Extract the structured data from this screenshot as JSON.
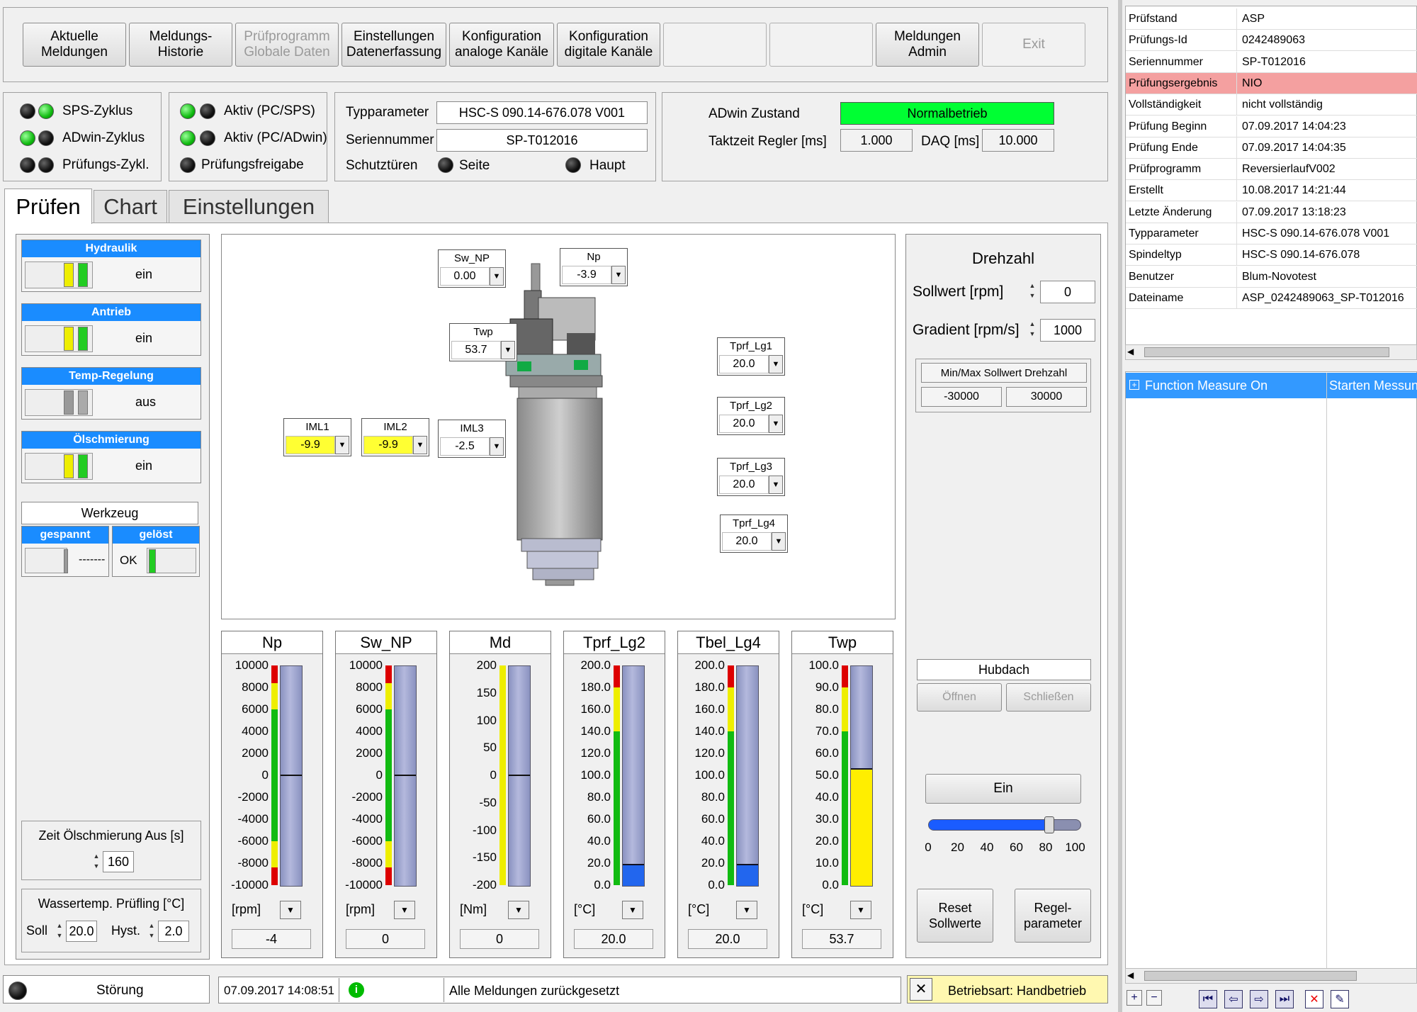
{
  "toolbar": {
    "aktuelle": "Aktuelle\nMeldungen",
    "historie": "Meldungs-\nHistorie",
    "pruefprogramm": "Prüfprogramm\nGlobale Daten",
    "einstellungen": "Einstellungen\nDatenerfassung",
    "analog": "Konfiguration\nanaloge Kanäle",
    "digital": "Konfiguration\ndigitale Kanäle",
    "admin": "Meldungen\nAdmin",
    "exit": "Exit"
  },
  "status": {
    "sps": "SPS-Zyklus",
    "adwin": "ADwin-Zyklus",
    "pruef_zykl": "Prüfungs-Zykl.",
    "aktiv_pc_sps": "Aktiv (PC/SPS)",
    "aktiv_pc_adwin": "Aktiv (PC/ADwin)",
    "freigabe": "Prüfungsfreigabe"
  },
  "info": {
    "typ_label": "Typparameter",
    "typ_value": "HSC-S 090.14-676.078 V001",
    "serien_label": "Seriennummer",
    "serien_value": "SP-T012016",
    "schutz_label": "Schutztüren",
    "seite": "Seite",
    "haupt": "Haupt"
  },
  "adwin": {
    "zustand_label": "ADwin Zustand",
    "zustand_value": "Normalbetrieb",
    "takt_label": "Taktzeit Regler [ms]",
    "takt_value": "1.000",
    "daq_label": "DAQ [ms]",
    "daq_value": "10.000",
    "status_color": "#00ff33"
  },
  "tabs": {
    "pruefen": "Prüfen",
    "chart": "Chart",
    "einstellungen": "Einstellungen"
  },
  "switches": [
    {
      "title": "Hydraulik",
      "value": "ein"
    },
    {
      "title": "Antrieb",
      "value": "ein"
    },
    {
      "title": "Temp-Regelung",
      "value": "aus"
    },
    {
      "title": "Ölschmierung",
      "value": "ein"
    }
  ],
  "werkzeug": {
    "title": "Werkzeug",
    "gespannt": "gespannt",
    "geloest": "gelöst",
    "gespannt_val": "-------",
    "geloest_val": "OK"
  },
  "oel_zeit": {
    "label": "Zeit Ölschmierung Aus [s]",
    "value": "160"
  },
  "wasser": {
    "label": "Wassertemp. Prüfling [°C]",
    "soll_label": "Soll",
    "soll": "20.0",
    "hyst_label": "Hyst.",
    "hyst": "2.0"
  },
  "sensors": {
    "sw_np": {
      "name": "Sw_NP",
      "value": "0.00"
    },
    "np": {
      "name": "Np",
      "value": "-3.9"
    },
    "twp": {
      "name": "Twp",
      "value": "53.7"
    },
    "iml1": {
      "name": "IML1",
      "value": "-9.9"
    },
    "iml2": {
      "name": "IML2",
      "value": "-9.9"
    },
    "iml3": {
      "name": "IML3",
      "value": "-2.5"
    },
    "lg1": {
      "name": "Tprf_Lg1",
      "value": "20.0"
    },
    "lg2": {
      "name": "Tprf_Lg2",
      "value": "20.0"
    },
    "lg3": {
      "name": "Tprf_Lg3",
      "value": "20.0"
    },
    "lg4": {
      "name": "Tprf_Lg4",
      "value": "20.0"
    }
  },
  "gauges": [
    {
      "title": "Np",
      "ticks": [
        "10000",
        "8000",
        "6000",
        "4000",
        "2000",
        "0",
        "-2000",
        "-4000",
        "-6000",
        "-8000",
        "-10000"
      ],
      "unit": "[rpm]",
      "value": "-4",
      "level": 0.5,
      "fill": "line",
      "scale": "symm"
    },
    {
      "title": "Sw_NP",
      "ticks": [
        "10000",
        "8000",
        "6000",
        "4000",
        "2000",
        "0",
        "-2000",
        "-4000",
        "-6000",
        "-8000",
        "-10000"
      ],
      "unit": "[rpm]",
      "value": "0",
      "level": 0.5,
      "fill": "line",
      "scale": "symm"
    },
    {
      "title": "Md",
      "ticks": [
        "200",
        "150",
        "100",
        "50",
        "0",
        "-50",
        "-100",
        "-150",
        "-200"
      ],
      "unit": "[Nm]",
      "value": "0",
      "level": 0.5,
      "fill": "line",
      "scale": "md"
    },
    {
      "title": "Tprf_Lg2",
      "ticks": [
        "200.0",
        "180.0",
        "160.0",
        "140.0",
        "120.0",
        "100.0",
        "80.0",
        "60.0",
        "40.0",
        "20.0",
        "0.0"
      ],
      "unit": "[°C]",
      "value": "20.0",
      "level": 0.1,
      "fill": "blue",
      "scale": "temp"
    },
    {
      "title": "Tbel_Lg4",
      "ticks": [
        "200.0",
        "180.0",
        "160.0",
        "140.0",
        "120.0",
        "100.0",
        "80.0",
        "60.0",
        "40.0",
        "20.0",
        "0.0"
      ],
      "unit": "[°C]",
      "value": "20.0",
      "level": 0.1,
      "fill": "blue",
      "scale": "temp"
    },
    {
      "title": "Twp",
      "ticks": [
        "100.0",
        "90.0",
        "80.0",
        "70.0",
        "60.0",
        "50.0",
        "40.0",
        "30.0",
        "20.0",
        "10.0",
        "0.0"
      ],
      "unit": "[°C]",
      "value": "53.7",
      "level": 0.537,
      "fill": "yellow",
      "scale": "temp"
    }
  ],
  "drehzahl": {
    "title": "Drehzahl",
    "soll_label": "Sollwert [rpm]",
    "soll": "0",
    "grad_label": "Gradient [rpm/s]",
    "grad": "1000",
    "minmax_label": "Min/Max Sollwert Drehzahl",
    "min": "-30000",
    "max": "30000"
  },
  "hubdach": {
    "title": "Hubdach",
    "oeffnen": "Öffnen",
    "schliessen": "Schließen"
  },
  "ein_button": "Ein",
  "slider": {
    "ticks": [
      "0",
      "20",
      "40",
      "60",
      "80",
      "100"
    ],
    "value": 80
  },
  "reset": "Reset\nSollwerte",
  "regel": "Regel-\nparameter",
  "footer": {
    "stoerung": "Störung",
    "timestamp": "07.09.2017 14:08:51",
    "message": "Alle Meldungen zurückgesetzt",
    "betriebsart": "Betriebsart: Handbetrieb"
  },
  "right_table": [
    {
      "k": "Prüfstand",
      "v": "ASP"
    },
    {
      "k": "Prüfungs-Id",
      "v": "0242489063"
    },
    {
      "k": "Seriennummer",
      "v": "SP-T012016"
    },
    {
      "k": "Prüfungsergebnis",
      "v": "NIO",
      "highlight": true
    },
    {
      "k": "Vollständigkeit",
      "v": "nicht vollständig"
    },
    {
      "k": "Prüfung Beginn",
      "v": "07.09.2017 14:04:23"
    },
    {
      "k": "Prüfung Ende",
      "v": "07.09.2017 14:04:35"
    },
    {
      "k": "Prüfprogramm",
      "v": "ReversierlaufV002"
    },
    {
      "k": "Erstellt",
      "v": "10.08.2017 14:21:44"
    },
    {
      "k": "Letzte Änderung",
      "v": "07.09.2017 13:18:23"
    },
    {
      "k": "Typparameter",
      "v": "HSC-S 090.14-676.078 V001"
    },
    {
      "k": "Spindeltyp",
      "v": "HSC-S 090.14-676.078"
    },
    {
      "k": "Benutzer",
      "v": "Blum-Novotest"
    },
    {
      "k": "Dateiname",
      "v": "ASP_0242489063_SP-T012016"
    }
  ],
  "functions": {
    "col1": "Function Measure On",
    "col2": "Starten Messung"
  },
  "colors": {
    "accent": "#1a8cff",
    "nio": "#f4a0a0",
    "betriebsart_bg": "#fff8b0"
  }
}
